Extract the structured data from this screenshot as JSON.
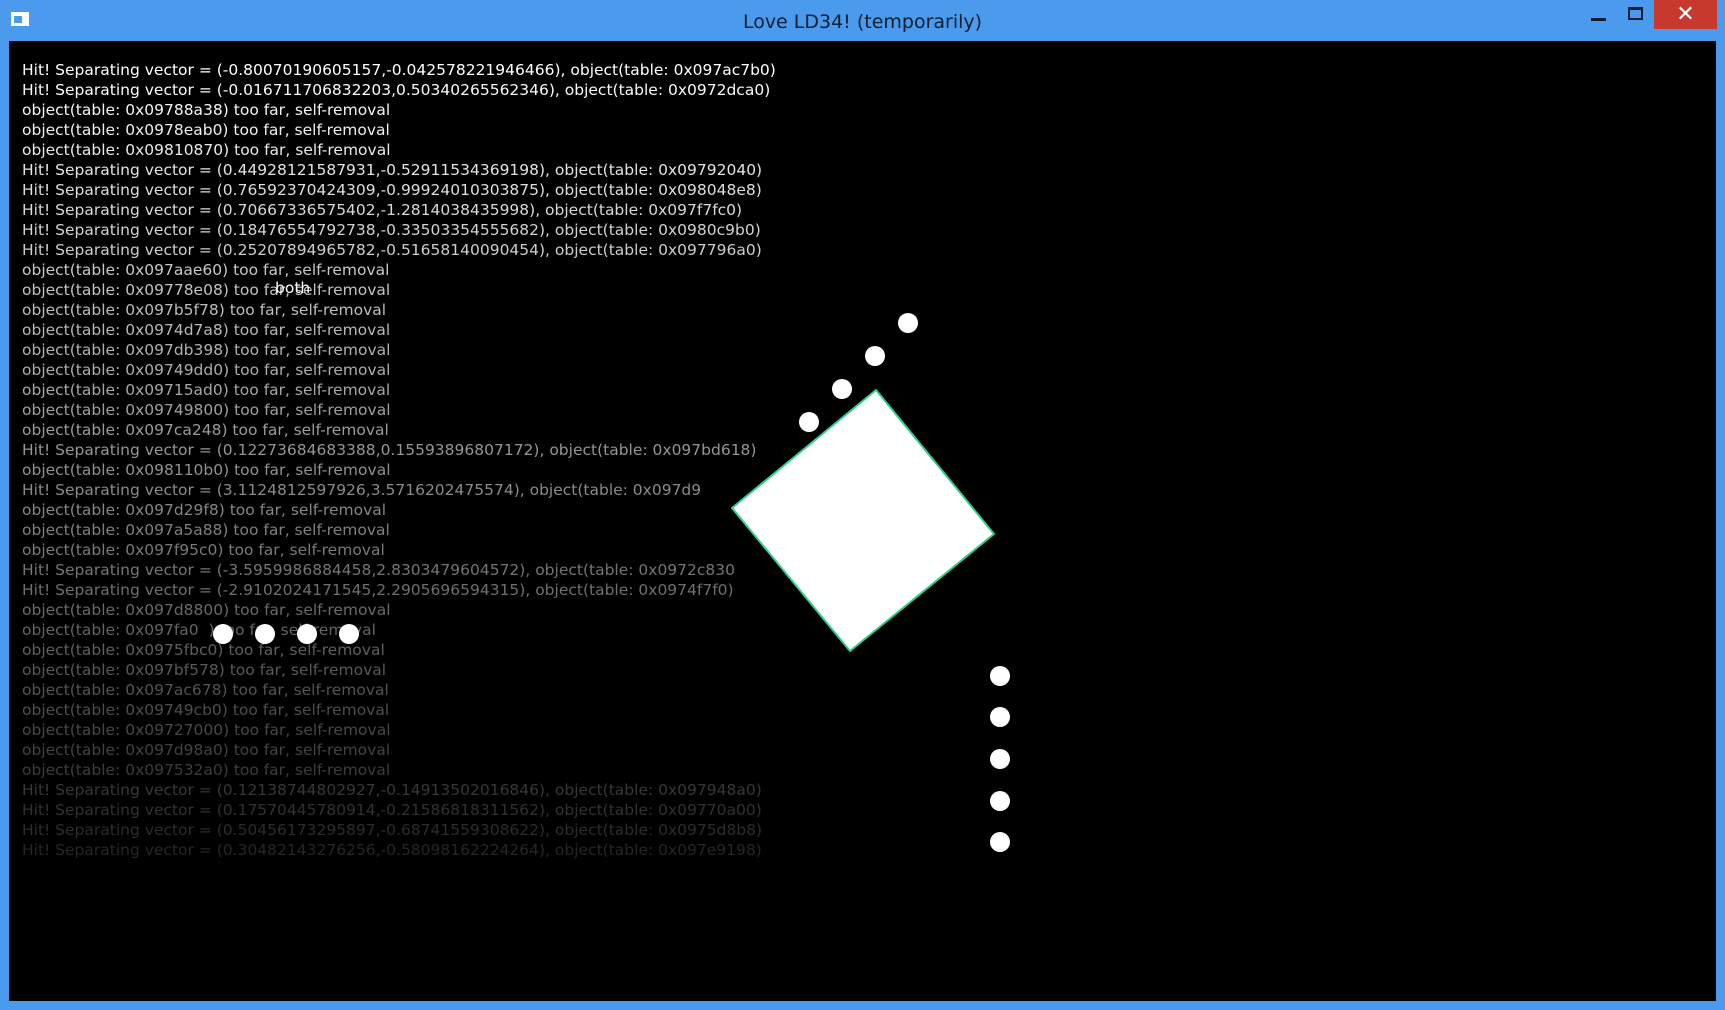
{
  "window": {
    "title": "Love LD34! (temporarily)",
    "close_glyph": "✕",
    "accent_color": "#4a9aed",
    "close_color": "#c7392c"
  },
  "overlay_label": "both",
  "log": [
    "Hit! Separating vector = (-0.80070190605157,-0.042578221946466), object(table: 0x097ac7b0)",
    "Hit! Separating vector = (-0.016711706832203,0.50340265562346), object(table: 0x0972dca0)",
    "object(table: 0x09788a38) too far, self-removal",
    "object(table: 0x0978eab0) too far, self-removal",
    "object(table: 0x09810870) too far, self-removal",
    "Hit! Separating vector = (0.44928121587931,-0.52911534369198), object(table: 0x09792040)",
    "Hit! Separating vector = (0.76592370424309,-0.99924010303875), object(table: 0x098048e8)",
    "Hit! Separating vector = (0.70667336575402,-1.2814038435998), object(table: 0x097f7fc0)",
    "Hit! Separating vector = (0.18476554792738,-0.33503354555682), object(table: 0x0980c9b0)",
    "Hit! Separating vector = (0.25207894965782,-0.51658140090454), object(table: 0x097796a0)",
    "object(table: 0x097aae60) too far, self-removal",
    "object(table: 0x09778e08) too far, self-removal",
    "object(table: 0x097b5f78) too far, self-removal",
    "object(table: 0x0974d7a8) too far, self-removal",
    "object(table: 0x097db398) too far, self-removal",
    "object(table: 0x09749dd0) too far, self-removal",
    "object(table: 0x09715ad0) too far, self-removal",
    "object(table: 0x09749800) too far, self-removal",
    "object(table: 0x097ca248) too far, self-removal",
    "Hit! Separating vector = (0.12273684683388,0.15593896807172), object(table: 0x097bd618)",
    "object(table: 0x098110b0) too far, self-removal",
    "Hit! Separating vector = (3.1124812597926,3.5716202475574), object(table: 0x097d9",
    "object(table: 0x097d29f8) too far, self-removal",
    "object(table: 0x097a5a88) too far, self-removal",
    "object(table: 0x097f95c0) too far, self-removal",
    "Hit! Separating vector = (-3.5959986884458,2.8303479604572), object(table: 0x0972c830",
    "Hit! Separating vector = (-2.9102024171545,2.2905696594315), object(table: 0x0974f7f0)",
    "object(table: 0x097d8800) too far, self-removal",
    "object(table: 0x097fa0  ) too far, self-removal",
    "object(table: 0x0975fbc0) too far, self-removal",
    "object(table: 0x097bf578) too far, self-removal",
    "object(table: 0x097ac678) too far, self-removal",
    "object(table: 0x09749cb0) too far, self-removal",
    "object(table: 0x09727000) too far, self-removal",
    "object(table: 0x097d98a0) too far, self-removal",
    "object(table: 0x097532a0) too far, self-removal",
    "Hit! Separating vector = (0.12138744802927,-0.14913502016846), object(table: 0x097948a0)",
    "Hit! Separating vector = (0.17570445780914,-0.21586818311562), object(table: 0x09770a00)",
    "Hit! Separating vector = (0.50456173295897,-0.68741559308622), object(table: 0x0975d8b8)",
    "Hit! Separating vector = (0.30482143276256,-0.58098162224264), object(table: 0x097e9198)"
  ]
}
